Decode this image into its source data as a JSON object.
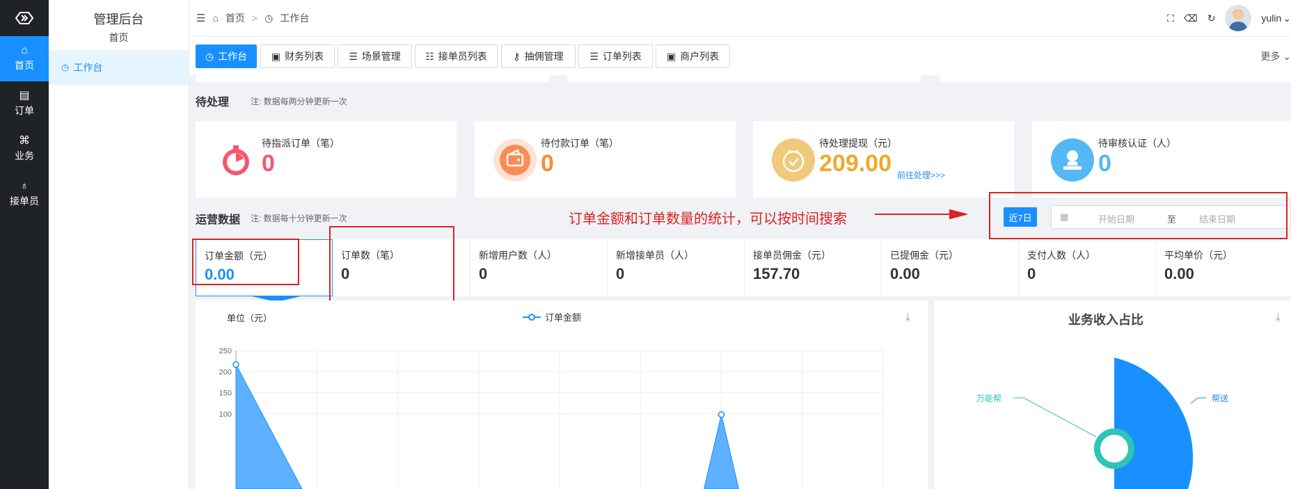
{
  "rail": {
    "items": [
      {
        "label": "首页",
        "icon": "home-icon",
        "glyph": "⌂"
      },
      {
        "label": "订单",
        "icon": "order-icon",
        "glyph": "▤"
      },
      {
        "label": "业务",
        "icon": "business-icon",
        "glyph": "⌘"
      },
      {
        "label": "接单员",
        "icon": "bike-icon",
        "glyph": "♁"
      }
    ]
  },
  "sidebar": {
    "title": "管理后台",
    "subtitle": "首页",
    "items": [
      {
        "label": "工作台",
        "icon": "dashboard-icon"
      }
    ]
  },
  "header": {
    "breadcrumb": {
      "home": "首页",
      "current": "工作台"
    },
    "user": "yulin"
  },
  "tabs": [
    {
      "label": "工作台",
      "icon": "dashboard-icon",
      "active": true
    },
    {
      "label": "财务列表"
    },
    {
      "label": "场景管理"
    },
    {
      "label": "接单员列表"
    },
    {
      "label": "抽佣管理"
    },
    {
      "label": "订单列表"
    },
    {
      "label": "商户列表"
    }
  ],
  "tabs_more": "更多",
  "pending": {
    "title": "待处理",
    "note": "注: 数据每两分钟更新一次",
    "cards": [
      {
        "label": "待指派订单（笔）",
        "value": "0",
        "color": "#f5576c"
      },
      {
        "label": "待付款订单（笔）",
        "value": "0",
        "color": "#fa8c35"
      },
      {
        "label": "待处理提现（元）",
        "value": "209.00",
        "color": "#f0a830",
        "link": "前往处理>>>"
      },
      {
        "label": "待审核认证（人）",
        "value": "0",
        "color": "#54b8f5"
      }
    ]
  },
  "ops": {
    "title": "运营数据",
    "note": "注: 数据每十分钟更新一次",
    "annotation": "订单金额和订单数量的统计，可以按时间搜索",
    "range_button": "近7日",
    "start_placeholder": "开始日期",
    "to": "至",
    "end_placeholder": "结束日期",
    "stats": [
      {
        "label": "订单金额（元）",
        "value": "0.00"
      },
      {
        "label": "订单数（笔）",
        "value": "0"
      },
      {
        "label": "新增用户数（人）",
        "value": "0"
      },
      {
        "label": "新增接单员（人）",
        "value": "0"
      },
      {
        "label": "接单员佣金（元）",
        "value": "157.70"
      },
      {
        "label": "已提佣金（元）",
        "value": "0.00"
      },
      {
        "label": "支付人数（人）",
        "value": "0"
      },
      {
        "label": "平均单价（元）",
        "value": "0.00"
      }
    ]
  },
  "chart_data": [
    {
      "type": "area",
      "ylabel": "单位（元）",
      "legend": "订单金额",
      "yticks": [
        100,
        150,
        200,
        250
      ],
      "visible_points": [
        {
          "index": 0,
          "y": 217
        },
        {
          "index": 6,
          "y": 98
        }
      ]
    },
    {
      "type": "pie",
      "title": "业务收入占比",
      "slices": [
        {
          "name": "帮送",
          "share": 0.35
        },
        {
          "name": "万能帮"
        }
      ]
    }
  ],
  "colors": {
    "accent": "#1890ff",
    "annotation": "#e02020"
  }
}
